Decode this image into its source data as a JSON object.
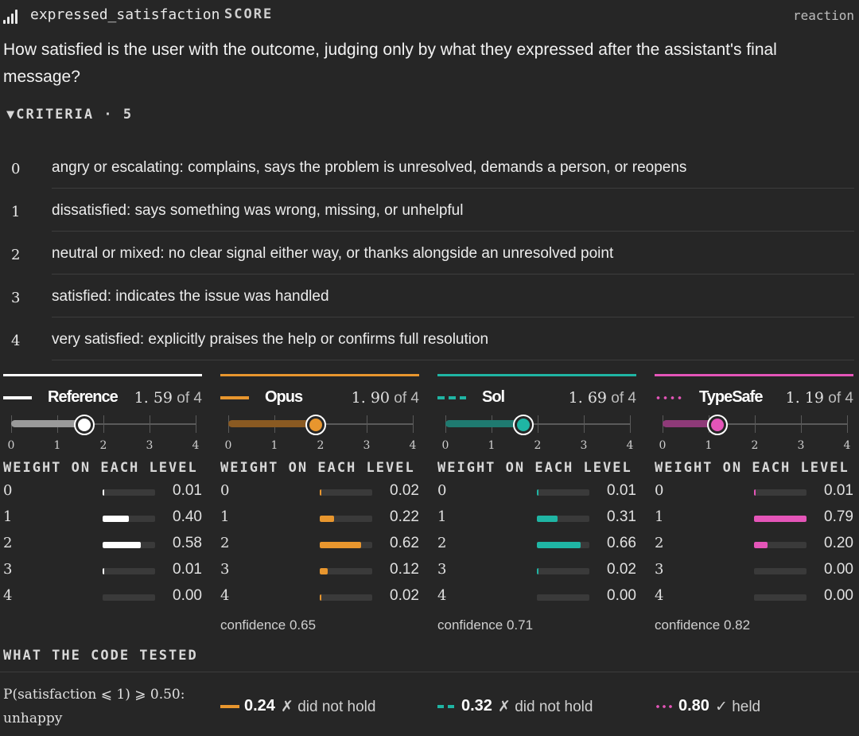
{
  "header": {
    "metric_name": "expressed_satisfaction",
    "score_tag": "SCORE",
    "reaction_tag": "reaction",
    "icon": "signal-bars-icon"
  },
  "question": "How satisfied is the user with the outcome, judging only by what they expressed after the assistant's final message?",
  "criteria": {
    "toggle_label": "▼CRITERIA · 5",
    "items": [
      {
        "level": "0",
        "text": "angry or escalating: complains, says the problem is unresolved, demands a person, or reopens"
      },
      {
        "level": "1",
        "text": "dissatisfied: says something was wrong, missing, or unhelpful"
      },
      {
        "level": "2",
        "text": "neutral or mixed: no clear signal either way, or thanks alongside an unresolved point"
      },
      {
        "level": "3",
        "text": "satisfied: indicates the issue was handled"
      },
      {
        "level": "4",
        "text": "very satisfied: explicitly praises the help or confirms full resolution"
      }
    ]
  },
  "weights_title": "WEIGHT ON EACH LEVEL",
  "axis_labels": [
    "0",
    "1",
    "2",
    "3",
    "4"
  ],
  "models": [
    {
      "name": "Reference",
      "legend_style": "solid",
      "color": "#ffffff",
      "fill_color": "#9a9a9a",
      "score_value": "1. 59",
      "score_of": " of 4",
      "score": 1.59,
      "weights": [
        {
          "level": "0",
          "value": "0.01",
          "w": 0.01
        },
        {
          "level": "1",
          "value": "0.40",
          "w": 0.4
        },
        {
          "level": "2",
          "value": "0.58",
          "w": 0.58
        },
        {
          "level": "3",
          "value": "0.01",
          "w": 0.01
        },
        {
          "level": "4",
          "value": "0.00",
          "w": 0.0
        }
      ],
      "confidence": ""
    },
    {
      "name": "Opus",
      "legend_style": "solid",
      "color": "#e8962e",
      "fill_color": "#8a5a22",
      "score_value": "1. 90",
      "score_of": " of 4",
      "score": 1.9,
      "weights": [
        {
          "level": "0",
          "value": "0.02",
          "w": 0.02
        },
        {
          "level": "1",
          "value": "0.22",
          "w": 0.22
        },
        {
          "level": "2",
          "value": "0.62",
          "w": 0.62
        },
        {
          "level": "3",
          "value": "0.12",
          "w": 0.12
        },
        {
          "level": "4",
          "value": "0.02",
          "w": 0.02
        }
      ],
      "confidence": "confidence 0.65"
    },
    {
      "name": "Sol",
      "legend_style": "dashed",
      "color": "#1fb5a4",
      "fill_color": "#1f7a70",
      "score_value": "1. 69",
      "score_of": " of 4",
      "score": 1.69,
      "weights": [
        {
          "level": "0",
          "value": "0.01",
          "w": 0.01
        },
        {
          "level": "1",
          "value": "0.31",
          "w": 0.31
        },
        {
          "level": "2",
          "value": "0.66",
          "w": 0.66
        },
        {
          "level": "3",
          "value": "0.02",
          "w": 0.02
        },
        {
          "level": "4",
          "value": "0.00",
          "w": 0.0
        }
      ],
      "confidence": "confidence 0.71"
    },
    {
      "name": "TypeSafe",
      "legend_style": "dotted",
      "color": "#e455b8",
      "fill_color": "#8e3a78",
      "score_value": "1. 19",
      "score_of": " of 4",
      "score": 1.19,
      "weights": [
        {
          "level": "0",
          "value": "0.01",
          "w": 0.01
        },
        {
          "level": "1",
          "value": "0.79",
          "w": 0.79
        },
        {
          "level": "2",
          "value": "0.20",
          "w": 0.2
        },
        {
          "level": "3",
          "value": "0.00",
          "w": 0.0
        },
        {
          "level": "4",
          "value": "0.00",
          "w": 0.0
        }
      ],
      "confidence": "confidence 0.82"
    }
  ],
  "tested": {
    "title": "WHAT THE CODE TESTED",
    "hypothesis": "P(satisfaction ⩽ 1) ⩾ 0.50: unhappy",
    "results": [
      {
        "model": "Opus",
        "value": "0.24",
        "verdict": "✗ did not hold",
        "legend_style": "solid",
        "color": "#e8962e"
      },
      {
        "model": "Sol",
        "value": "0.32",
        "verdict": "✗ did not hold",
        "legend_style": "dashed",
        "color": "#1fb5a4"
      },
      {
        "model": "TypeSafe",
        "value": "0.80",
        "verdict": "✓ held",
        "legend_style": "dotted",
        "color": "#e455b8"
      }
    ]
  }
}
